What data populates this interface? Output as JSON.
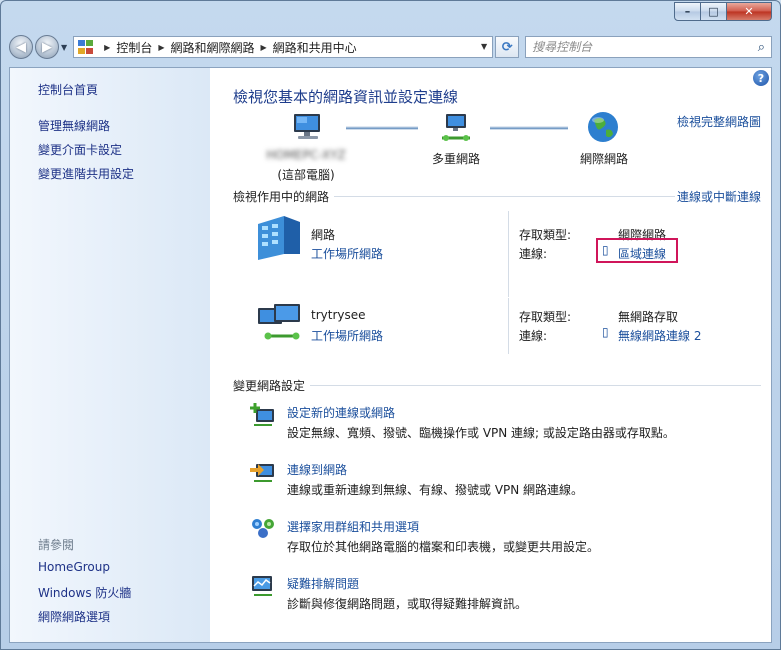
{
  "window": {
    "caption_buttons": {
      "minimize": "–",
      "maximize": "□",
      "close": "✕"
    }
  },
  "navbar": {
    "back_glyph": "◀",
    "forward_glyph": "▶",
    "breadcrumbs": [
      "控制台",
      "網路和網際網路",
      "網路和共用中心"
    ],
    "search_placeholder": "搜尋控制台"
  },
  "sidebar": {
    "items": [
      {
        "label": "控制台首頁"
      },
      {
        "label": "管理無線網路"
      },
      {
        "label": "變更介面卡設定"
      },
      {
        "label": "變更進階共用設定"
      }
    ],
    "see_also_title": "請參閱",
    "see_also": [
      {
        "label": "HomeGroup"
      },
      {
        "label": "Windows 防火牆"
      },
      {
        "label": "網際網路選項"
      }
    ]
  },
  "main": {
    "title": "檢視您基本的網路資訊並設定連線",
    "view_full_map": "檢視完整網路圖",
    "map": {
      "computer_name": "HOMEPC-XYZ",
      "computer_sub": "(這部電腦)",
      "multi_network": "多重網路",
      "internet": "網際網路"
    },
    "active_title": "檢視作用中的網路",
    "connect_disconnect": "連線或中斷連線",
    "networks": [
      {
        "name": "網路",
        "type": "工作場所網路",
        "access_label": "存取類型:",
        "access_value": "網際網路",
        "conn_label": "連線:",
        "conn_value": "區域連線"
      },
      {
        "name": "trytrysee",
        "type": "工作場所網路",
        "access_label": "存取類型:",
        "access_value": "無網路存取",
        "conn_label": "連線:",
        "conn_value": "無線網路連線 2"
      }
    ],
    "change_title": "變更網路設定",
    "tasks": [
      {
        "title": "設定新的連線或網路",
        "desc": "設定無線、寬頻、撥號、臨機操作或 VPN 連線; 或設定路由器或存取點。"
      },
      {
        "title": "連線到網路",
        "desc": "連線或重新連線到無線、有線、撥號或 VPN 網路連線。"
      },
      {
        "title": "選擇家用群組和共用選項",
        "desc": "存取位於其他網路電腦的檔案和印表機，或變更共用設定。"
      },
      {
        "title": "疑難排解問題",
        "desc": "診斷與修復網路問題，或取得疑難排解資訊。"
      }
    ]
  }
}
